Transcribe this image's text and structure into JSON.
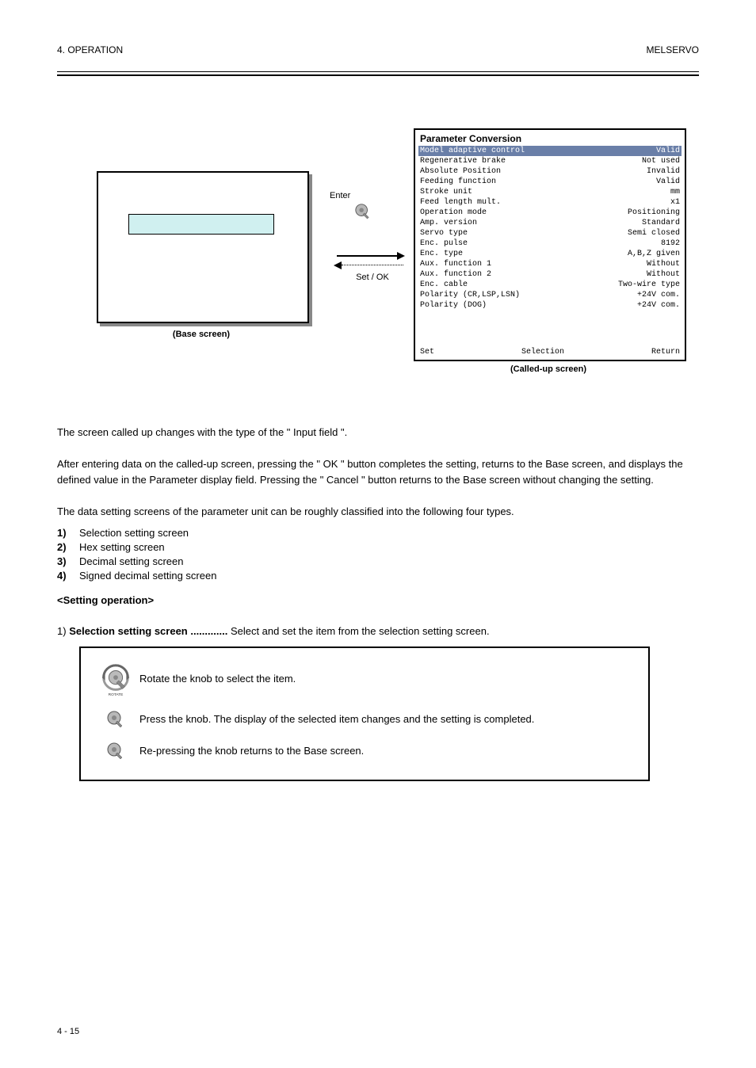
{
  "header": {
    "left": "4. OPERATION",
    "right": "MELSERVO"
  },
  "figure": {
    "base_caption": "(Base screen)",
    "enter_label": "Enter",
    "set_ok_label": "Set / OK",
    "called_caption": "(Called-up screen)",
    "called_title": "Parameter Conversion",
    "called_rows": [
      {
        "name": "Model adaptive control",
        "value": "Valid"
      },
      {
        "name": "Regenerative brake",
        "value": "Not used"
      },
      {
        "name": "Absolute Position",
        "value": "Invalid"
      },
      {
        "name": "Feeding function",
        "value": "Valid"
      },
      {
        "name": "Stroke unit",
        "value": "mm"
      },
      {
        "name": "Feed length mult.",
        "value": "x1"
      },
      {
        "name": "Operation mode",
        "value": "Positioning"
      },
      {
        "name": "Amp. version",
        "value": "Standard"
      },
      {
        "name": "Servo type",
        "value": "Semi closed"
      },
      {
        "name": "Enc. pulse",
        "value": "8192"
      },
      {
        "name": "Enc. type",
        "value": "A,B,Z given"
      },
      {
        "name": "Aux. function 1",
        "value": "Without"
      },
      {
        "name": "Aux. function 2",
        "value": "Without"
      },
      {
        "name": "Enc. cable",
        "value": "Two-wire type"
      },
      {
        "name": "Polarity (CR,LSP,LSN)",
        "value": "+24V com."
      },
      {
        "name": "Polarity (DOG)",
        "value": "+24V com."
      }
    ],
    "called_footer": {
      "left": "Set",
      "center": "Selection",
      "right": "Return"
    }
  },
  "para1": "The screen called up changes with the type of the \" Input field \".",
  "para2": "After entering data on the called-up screen, pressing the \" OK \" button completes the setting, returns to the Base screen, and displays the defined value in the Parameter display field. Pressing the \" Cancel \" button returns to the Base screen without changing the setting.",
  "para3": "The data setting screens of the parameter unit can be roughly classified into the following four types.",
  "bullets": [
    {
      "label": "1)",
      "text": "Selection setting screen"
    },
    {
      "label": "2)",
      "text": "Hex setting screen"
    },
    {
      "label": "3)",
      "text": "Decimal setting screen"
    },
    {
      "label": "4)",
      "text": "Signed decimal setting screen"
    }
  ],
  "section_label": "<Setting operation>",
  "step_num": "1)",
  "step_bold": "Selection setting screen .............",
  "step_rest": "Select and set the item from the selection setting screen.",
  "proc": {
    "row1": "Rotate the knob to select the item.",
    "row2": "Press the knob. The display of the selected item changes and the setting is completed.",
    "row3": "Re-pressing the knob returns to the Base screen."
  },
  "footer": {
    "left": "4 - 15",
    "right": ""
  }
}
